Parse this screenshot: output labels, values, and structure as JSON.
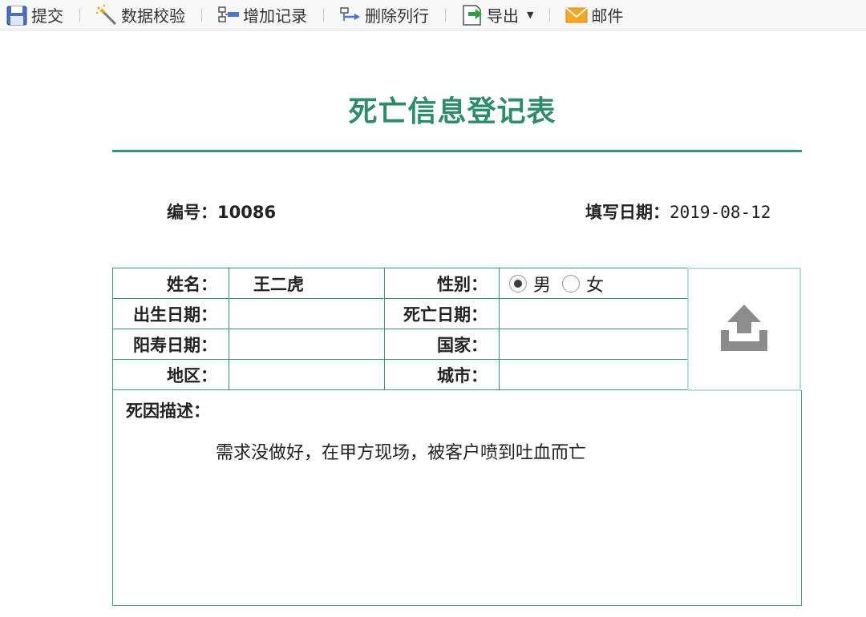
{
  "toolbar": {
    "submit": {
      "label": "提交",
      "icon": "save-icon"
    },
    "validate": {
      "label": "数据校验",
      "icon": "wand-icon"
    },
    "add_record": {
      "label": "增加记录",
      "icon": "add-row-icon"
    },
    "delete_row": {
      "label": "删除列行",
      "icon": "delete-row-icon"
    },
    "export": {
      "label": "导出",
      "icon": "export-icon",
      "has_dropdown": true
    },
    "mail": {
      "label": "邮件",
      "icon": "mail-icon"
    }
  },
  "form": {
    "title": "死亡信息登记表",
    "id_label": "编号：",
    "id_value": "10086",
    "date_label": "填写日期：",
    "date_value": "2019-08-12",
    "fields": {
      "name": {
        "label": "姓名：",
        "value": "王二虎"
      },
      "gender": {
        "label": "性别：",
        "options": [
          "男",
          "女"
        ],
        "selected": "男"
      },
      "birth_date": {
        "label": "出生日期：",
        "value": ""
      },
      "death_date": {
        "label": "死亡日期：",
        "value": ""
      },
      "lifespan": {
        "label": "阳寿日期：",
        "value": ""
      },
      "country": {
        "label": "国家：",
        "value": ""
      },
      "region": {
        "label": "地区：",
        "value": ""
      },
      "city": {
        "label": "城市：",
        "value": ""
      }
    },
    "photo_upload": {
      "icon": "upload-icon"
    },
    "cause": {
      "label": "死因描述：",
      "value": "需求没做好，在甲方现场，被客户喷到吐血而亡"
    }
  },
  "colors": {
    "accent": "#2e8b6e",
    "border": "#3b8f7c",
    "upload_border": "#b8dbe6",
    "upload_icon": "#8c8c8c"
  }
}
